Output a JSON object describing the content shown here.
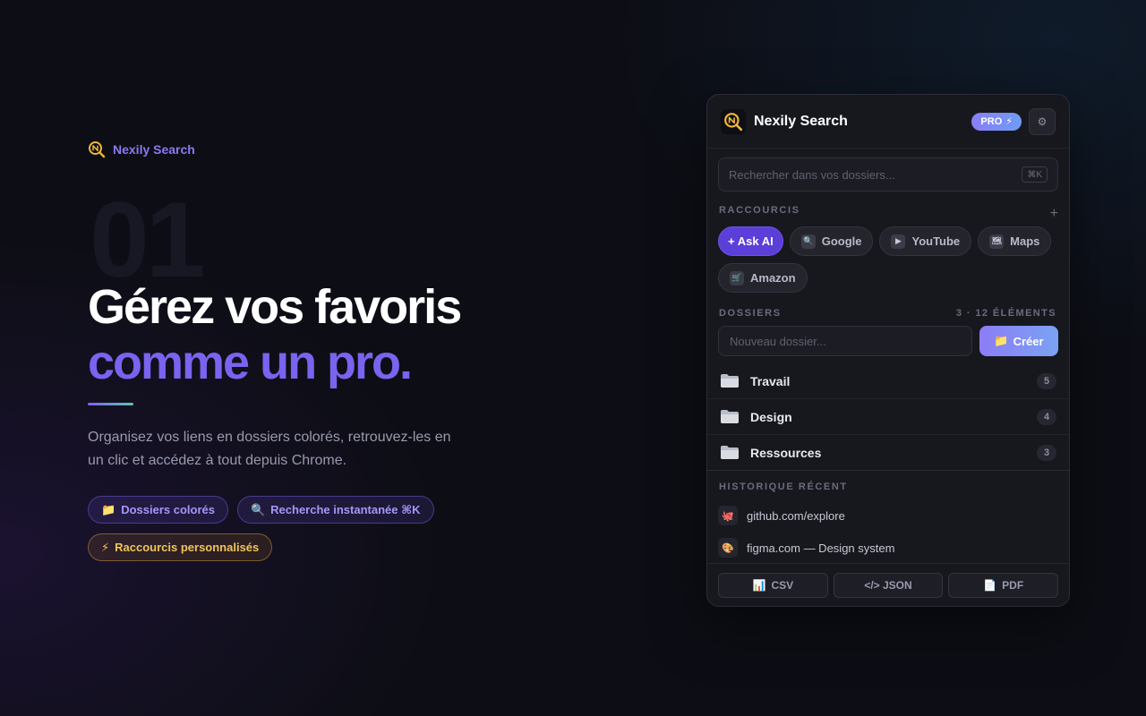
{
  "hero": {
    "brand": "Nexily Search",
    "number": "01",
    "headline_line1": "Gérez vos favoris",
    "headline_line2": "comme un pro.",
    "lead": "Organisez vos liens en dossiers colorés, retrouvez-les en un clic et accédez à tout depuis Chrome.",
    "chips": [
      {
        "icon": "folder-icon",
        "label": "Dossiers colorés"
      },
      {
        "icon": "magnifier-icon",
        "label": "Recherche instantanée ⌘K"
      },
      {
        "icon": "lightning-icon",
        "label": "Raccourcis personnalisés"
      }
    ]
  },
  "panel": {
    "title": "Nexily Search",
    "pro_badge": "PRO",
    "search_placeholder": "Rechercher dans vos dossiers...",
    "search_shortcut": "⌘K",
    "shortcuts_label": "RACCOURCIS",
    "shortcuts": [
      {
        "icon": "plus-icon",
        "label": "+ Ask AI"
      },
      {
        "icon": "magnifier-icon",
        "label": "Google"
      },
      {
        "icon": "play-icon",
        "label": "YouTube"
      },
      {
        "icon": "map-icon",
        "label": "Maps"
      },
      {
        "icon": "cart-icon",
        "label": "Amazon"
      }
    ],
    "folders_label": "DOSSIERS",
    "folders_count": "3 · 12 ÉLÉMENTS",
    "new_folder_placeholder": "Nouveau dossier...",
    "create_label": "Créer",
    "folders": [
      {
        "name": "Travail",
        "count": "5"
      },
      {
        "name": "Design",
        "count": "4"
      },
      {
        "name": "Ressources",
        "count": "3"
      }
    ],
    "history_label": "HISTORIQUE RÉCENT",
    "history": [
      {
        "icon": "octopus-icon",
        "label": "github.com/explore"
      },
      {
        "icon": "palette-icon",
        "label": "figma.com — Design system"
      }
    ],
    "exports": [
      {
        "icon": "bar-chart-icon",
        "label": "CSV"
      },
      {
        "icon": "code-icon",
        "label": "</> JSON"
      },
      {
        "icon": "document-icon",
        "label": "PDF"
      }
    ]
  },
  "colors": {
    "accent": "#7a63ee",
    "background": "#0d0e15",
    "panel": "#17181e",
    "gold": "#f0c45a"
  }
}
